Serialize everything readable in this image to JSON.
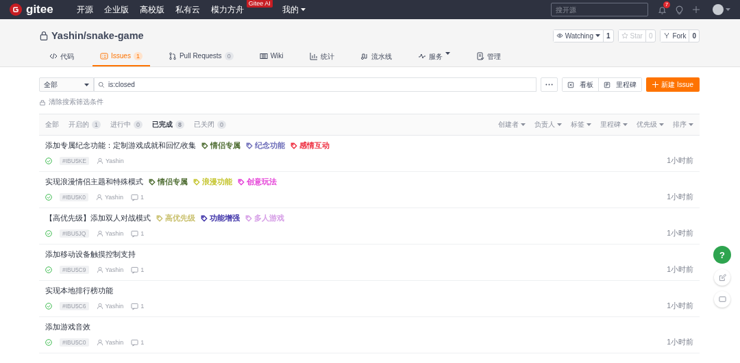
{
  "top_nav": {
    "logo": "gitee",
    "items": [
      {
        "label": "开源"
      },
      {
        "label": "企业版"
      },
      {
        "label": "高校版"
      },
      {
        "label": "私有云"
      },
      {
        "label": "模力方舟",
        "badge": "Gitee AI"
      },
      {
        "label": "我的",
        "dropdown": true
      }
    ],
    "search": {
      "placeholder": "搜开源"
    },
    "notifications": "7"
  },
  "repo": {
    "title": "Yashin/snake-game",
    "actions": [
      {
        "label": "Watching",
        "count": "1",
        "dropdown": true,
        "disabled": false
      },
      {
        "label": "Star",
        "count": "0",
        "dropdown": false,
        "disabled": true
      },
      {
        "label": "Fork",
        "count": "0",
        "dropdown": false,
        "disabled": false
      }
    ]
  },
  "repo_tabs": [
    {
      "label": "代码",
      "selected": false
    },
    {
      "label": "Issues",
      "count": "1",
      "selected": true
    },
    {
      "label": "Pull Requests",
      "count": "0",
      "selected": false
    },
    {
      "label": "Wiki",
      "selected": false
    },
    {
      "label": "统计",
      "selected": false
    },
    {
      "label": "流水线",
      "selected": false
    },
    {
      "label": "服务",
      "dropdown": true,
      "selected": false
    },
    {
      "label": "管理",
      "selected": false
    }
  ],
  "toolbar": {
    "scope": "全部",
    "search": "is:closed",
    "board": "看板",
    "milestone": "里程碑",
    "new_issue": "新建 Issue"
  },
  "clear_filters": "清除搜索筛选条件",
  "state_tabs": [
    {
      "label": "全部",
      "selected": false
    },
    {
      "label": "开启的",
      "count": "1",
      "selected": false
    },
    {
      "label": "进行中",
      "count": "0",
      "selected": false
    },
    {
      "label": "已完成",
      "count": "8",
      "selected": true
    },
    {
      "label": "已关闭",
      "count": "0",
      "selected": false
    }
  ],
  "sort_filters": [
    "创建者",
    "负责人",
    "标签",
    "里程碑",
    "优先级",
    "排序"
  ],
  "issues": [
    {
      "title": "添加专属纪念功能：定制游戏成就和回忆收集",
      "labels": [
        {
          "text": "情侣专属",
          "color": "#4b6a2e"
        },
        {
          "text": "纪念功能",
          "color": "#6b6bb8"
        },
        {
          "text": "感情互动",
          "color": "#ee2a3c"
        }
      ],
      "id": "#IBU5KE",
      "author": "Yashin",
      "time": "1小时前"
    },
    {
      "title": "实现浪漫情侣主题和特殊模式",
      "labels": [
        {
          "text": "情侣专属",
          "color": "#4b6a2e"
        },
        {
          "text": "浪漫功能",
          "color": "#c4c42c"
        },
        {
          "text": "创意玩法",
          "color": "#e43bd6"
        }
      ],
      "id": "#IBU5K0",
      "author": "Yashin",
      "comments": "1",
      "time": "1小时前"
    },
    {
      "title": "【高优先级】添加双人对战模式",
      "labels": [
        {
          "text": "高优先级",
          "color": "#c8bf6a"
        },
        {
          "text": "功能增强",
          "color": "#3a2ea6"
        },
        {
          "text": "多人游戏",
          "color": "#d59ce6"
        }
      ],
      "id": "#IBU5JQ",
      "author": "Yashin",
      "comments": "1",
      "time": "1小时前"
    },
    {
      "title": "添加移动设备触摸控制支持",
      "id": "#IBU5C9",
      "author": "Yashin",
      "comments": "1",
      "time": "1小时前"
    },
    {
      "title": "实现本地排行榜功能",
      "id": "#IBU5C6",
      "author": "Yashin",
      "comments": "1",
      "time": "1小时前"
    },
    {
      "title": "添加游戏音效",
      "id": "#IBU5C0",
      "author": "Yashin",
      "comments": "1",
      "time": "1小时前"
    }
  ],
  "float_buttons": {
    "help": "?"
  }
}
